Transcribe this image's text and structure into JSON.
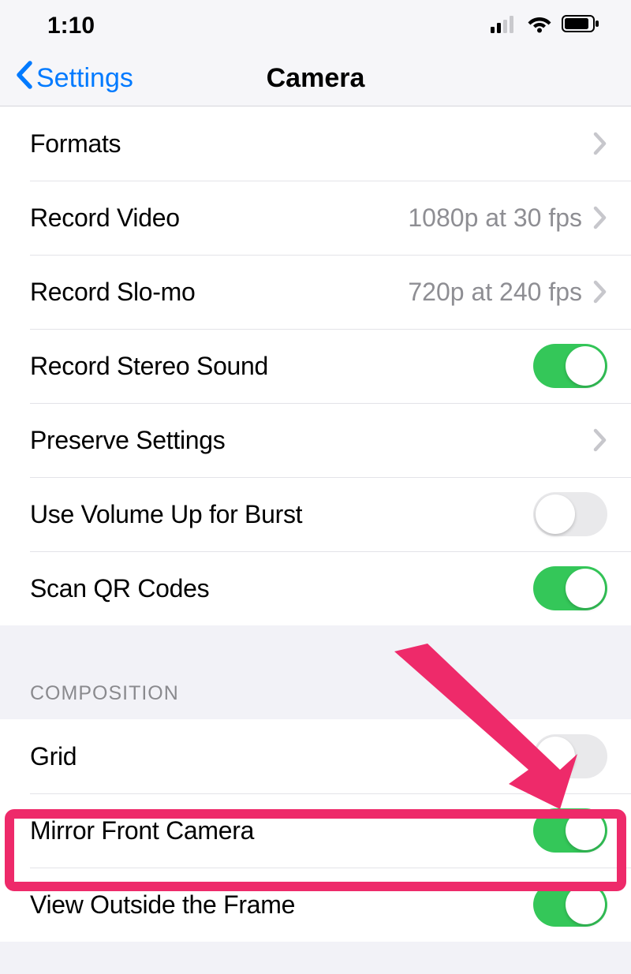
{
  "status_bar": {
    "time": "1:10"
  },
  "nav": {
    "back_label": "Settings",
    "title": "Camera"
  },
  "section1": {
    "formats": {
      "label": "Formats"
    },
    "record_video": {
      "label": "Record Video",
      "value": "1080p at 30 fps"
    },
    "record_slomo": {
      "label": "Record Slo-mo",
      "value": "720p at 240 fps"
    },
    "stereo": {
      "label": "Record Stereo Sound",
      "on": true
    },
    "preserve": {
      "label": "Preserve Settings"
    },
    "volume_burst": {
      "label": "Use Volume Up for Burst",
      "on": false
    },
    "scan_qr": {
      "label": "Scan QR Codes",
      "on": true
    }
  },
  "section2": {
    "header": "COMPOSITION",
    "grid": {
      "label": "Grid",
      "on": false
    },
    "mirror": {
      "label": "Mirror Front Camera",
      "on": true
    },
    "outside_frame": {
      "label": "View Outside the Frame",
      "on": true
    }
  },
  "annotation": {
    "highlight_color": "#ee2a6a"
  }
}
